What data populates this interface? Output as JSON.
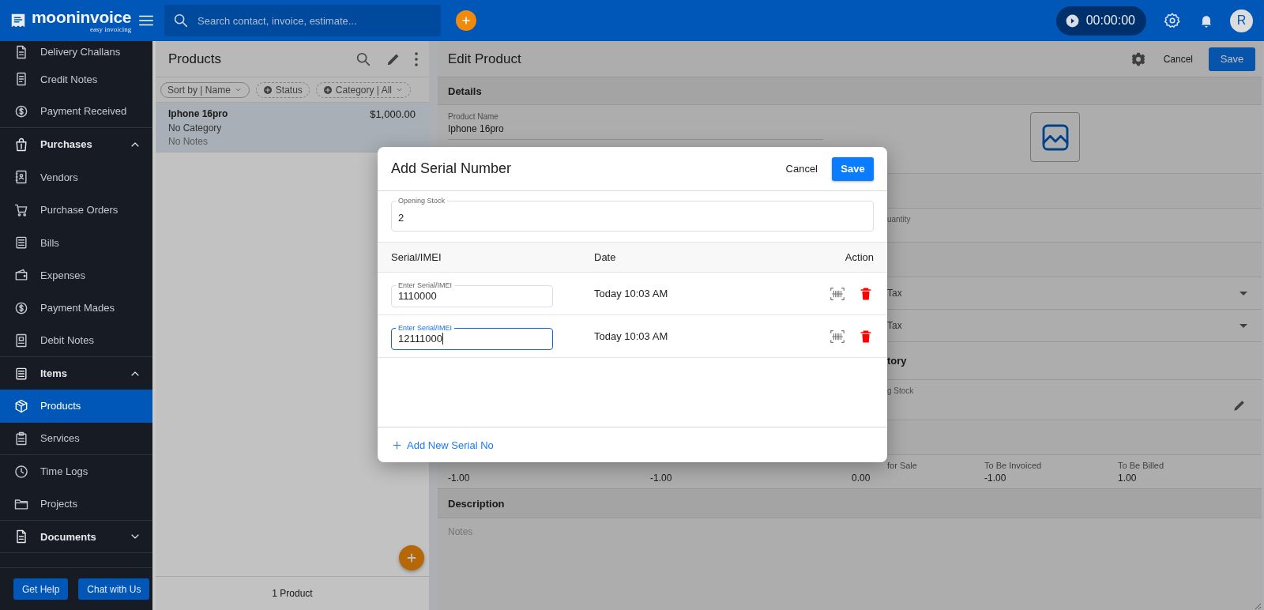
{
  "header": {
    "logo": {
      "name": "mooninvoice",
      "tagline": "easy invoicing"
    },
    "search": {
      "placeholder": "Search contact, invoice, estimate..."
    },
    "timer": "00:00:00",
    "avatar": "R"
  },
  "sidebar": {
    "items": [
      {
        "label": "Delivery Challans",
        "kind": "item",
        "selected": false,
        "divider": false
      },
      {
        "label": "Credit Notes",
        "kind": "item",
        "selected": false,
        "divider": false
      },
      {
        "label": "Payment Received",
        "kind": "item",
        "selected": false,
        "divider": true
      },
      {
        "label": "Purchases",
        "kind": "section",
        "expanded": true,
        "selected": false,
        "divider": false
      },
      {
        "label": "Vendors",
        "kind": "item",
        "selected": false,
        "divider": false
      },
      {
        "label": "Purchase Orders",
        "kind": "item",
        "selected": false,
        "divider": false
      },
      {
        "label": "Bills",
        "kind": "item",
        "selected": false,
        "divider": false
      },
      {
        "label": "Expenses",
        "kind": "item",
        "selected": false,
        "divider": false
      },
      {
        "label": "Payment Mades",
        "kind": "item",
        "selected": false,
        "divider": false
      },
      {
        "label": "Debit Notes",
        "kind": "item",
        "selected": false,
        "divider": true
      },
      {
        "label": "Items",
        "kind": "section",
        "expanded": true,
        "selected": false,
        "divider": false
      },
      {
        "label": "Products",
        "kind": "item",
        "selected": true,
        "divider": false
      },
      {
        "label": "Services",
        "kind": "item",
        "selected": false,
        "divider": true
      },
      {
        "label": "Time Logs",
        "kind": "item",
        "selected": false,
        "divider": false
      },
      {
        "label": "Projects",
        "kind": "item",
        "selected": false,
        "divider": true
      },
      {
        "label": "Documents",
        "kind": "section",
        "expanded": false,
        "selected": false,
        "divider": true
      }
    ],
    "buttons": [
      "Get Help",
      "Chat with Us"
    ]
  },
  "products": {
    "title": "Products",
    "chips": [
      {
        "label": "Sort by | Name",
        "kind": "sort",
        "dropdown": true
      },
      {
        "label": "Status",
        "kind": "filter",
        "dropdown": false
      },
      {
        "label": "Category | All",
        "kind": "filter",
        "dropdown": true
      }
    ],
    "items": [
      {
        "name": "Iphone 16pro",
        "price": "$1,000.00",
        "category": "No Category",
        "notes": "No Notes",
        "selected": true
      }
    ],
    "count": "1 Product"
  },
  "edit_product": {
    "title": "Edit Product",
    "cancel": "Cancel",
    "save": "Save",
    "details": {
      "heading": "Details",
      "product_name": {
        "label": "Product Name",
        "value": "Iphone 16pro"
      }
    },
    "rows": [
      {
        "kind": "band"
      },
      {
        "kind": "field",
        "label": "uantity"
      },
      {
        "kind": "band"
      },
      {
        "kind": "select",
        "label": "Tax"
      },
      {
        "kind": "select",
        "label": "Tax"
      },
      {
        "kind": "heading",
        "label": "tory"
      },
      {
        "kind": "stock",
        "label": "g Stock"
      },
      {
        "kind": "band"
      }
    ],
    "stats": [
      {
        "value": "-1.00"
      },
      {
        "value": "-1.00"
      },
      {
        "label": "for Sale",
        "value": "0.00"
      },
      {
        "label": "To Be Invoiced",
        "value": "-1.00"
      },
      {
        "label": "To Be Billed",
        "value": "1.00"
      }
    ],
    "description": {
      "heading": "Description",
      "placeholder": "Notes"
    }
  },
  "modal": {
    "title": "Add Serial Number",
    "cancel": "Cancel",
    "save": "Save",
    "opening_stock": {
      "label": "Opening Stock",
      "value": "2"
    },
    "columns": [
      "Serial/IMEI",
      "Date",
      "Action"
    ],
    "rows": [
      {
        "label": "Enter Serial/IMEI",
        "value": "1110000",
        "date": "Today 10:03 AM",
        "focused": false
      },
      {
        "label": "Enter Serial/IMEI",
        "value": "12111000",
        "date": "Today 10:03 AM",
        "focused": true
      }
    ],
    "add_link": "Add New Serial No"
  }
}
